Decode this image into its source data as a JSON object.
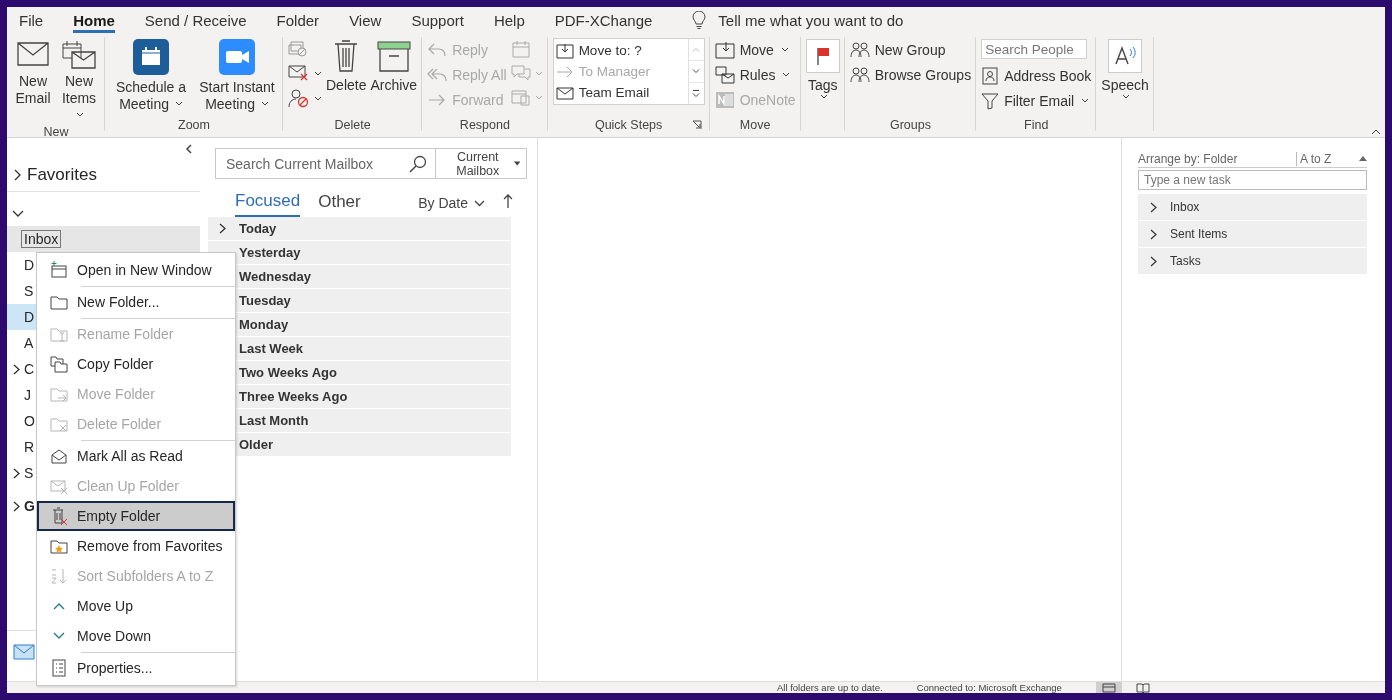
{
  "ribbon_tabs": [
    {
      "label": "File",
      "selected": false
    },
    {
      "label": "Home",
      "selected": true
    },
    {
      "label": "Send / Receive",
      "selected": false
    },
    {
      "label": "Folder",
      "selected": false
    },
    {
      "label": "View",
      "selected": false
    },
    {
      "label": "Support",
      "selected": false
    },
    {
      "label": "Help",
      "selected": false
    },
    {
      "label": "PDF-XChange",
      "selected": false
    }
  ],
  "tell_me": {
    "text": "Tell me what you want to do"
  },
  "ribbon": {
    "new": {
      "label": "New",
      "buttons": [
        {
          "label": "New Email",
          "dropdown": false
        },
        {
          "label": "New Items",
          "dropdown": true
        }
      ]
    },
    "zoom": {
      "label": "Zoom",
      "buttons": [
        {
          "label": "Schedule a Meeting",
          "dropdown": true
        },
        {
          "label": "Start Instant Meeting",
          "dropdown": true
        }
      ]
    },
    "delete": {
      "label": "Delete",
      "buttons": [
        {
          "label": "Delete"
        },
        {
          "label": "Archive"
        }
      ]
    },
    "respond": {
      "label": "Respond",
      "buttons": [
        {
          "label": "Reply",
          "disabled": true
        },
        {
          "label": "Reply All",
          "disabled": true
        },
        {
          "label": "Forward",
          "disabled": true
        }
      ]
    },
    "quick_steps": {
      "label": "Quick Steps",
      "items": [
        {
          "label": "Move to: ?",
          "disabled": false
        },
        {
          "label": "To Manager",
          "disabled": true
        },
        {
          "label": "Team Email",
          "disabled": false
        }
      ]
    },
    "move": {
      "label": "Move",
      "buttons": [
        {
          "label": "Move",
          "dropdown": true,
          "disabled": false
        },
        {
          "label": "Rules",
          "dropdown": true,
          "disabled": false
        },
        {
          "label": "OneNote",
          "dropdown": false,
          "disabled": true
        }
      ]
    },
    "tags": {
      "button": "Tags"
    },
    "groups": {
      "label": "Groups",
      "buttons": [
        "New Group",
        "Browse Groups"
      ]
    },
    "find": {
      "label": "Find",
      "search": {
        "placeholder": "Search People"
      },
      "buttons": [
        {
          "label": "Address Book",
          "dropdown": false
        },
        {
          "label": "Filter Email",
          "dropdown": true
        }
      ]
    },
    "speech": {
      "button": "Speech"
    }
  },
  "folder_pane": {
    "favorites": {
      "label": "Favorites",
      "expanded": false
    },
    "account": {
      "expanded": true
    },
    "folders": [
      {
        "label": "Inbox",
        "selected": false,
        "context_target": true,
        "collapsed": false,
        "bold": false
      },
      {
        "label": "D",
        "selected": false,
        "context_target": false,
        "collapsed": false,
        "bold": false
      },
      {
        "label": "S",
        "selected": false,
        "context_target": false,
        "collapsed": false,
        "bold": false
      },
      {
        "label": "D",
        "selected": true,
        "context_target": false,
        "collapsed": false,
        "bold": false
      },
      {
        "label": "A",
        "selected": false,
        "context_target": false,
        "collapsed": false,
        "bold": false
      },
      {
        "label": "C",
        "selected": false,
        "context_target": false,
        "collapsed": true,
        "bold": false
      },
      {
        "label": "J",
        "selected": false,
        "context_target": false,
        "collapsed": false,
        "bold": false
      },
      {
        "label": "O",
        "selected": false,
        "context_target": false,
        "collapsed": false,
        "bold": false
      },
      {
        "label": "R",
        "selected": false,
        "context_target": false,
        "collapsed": false,
        "bold": false
      },
      {
        "label": "S",
        "selected": false,
        "context_target": false,
        "collapsed": true,
        "bold": false
      },
      {
        "label": "G",
        "selected": false,
        "context_target": false,
        "collapsed": true,
        "bold": true
      }
    ]
  },
  "message_list": {
    "search": {
      "placeholder": "Search Current Mailbox"
    },
    "scope": "Current Mailbox",
    "tabs": [
      {
        "label": "Focused",
        "selected": true
      },
      {
        "label": "Other",
        "selected": false
      }
    ],
    "sort": "By Date",
    "groups": [
      {
        "label": "Today",
        "collapsed": true
      },
      {
        "label": "Yesterday"
      },
      {
        "label": "Wednesday"
      },
      {
        "label": "Tuesday"
      },
      {
        "label": "Monday"
      },
      {
        "label": "Last Week"
      },
      {
        "label": "Two Weeks Ago"
      },
      {
        "label": "Three Weeks Ago"
      },
      {
        "label": "Last Month"
      },
      {
        "label": "Older"
      }
    ]
  },
  "context_menu": [
    {
      "label": "Open in New Window",
      "disabled": false,
      "selected": false,
      "separator_after": true
    },
    {
      "label": "New Folder...",
      "disabled": false,
      "selected": false,
      "separator_after": true
    },
    {
      "label": "Rename Folder",
      "disabled": true,
      "selected": false,
      "separator_after": false
    },
    {
      "label": "Copy Folder",
      "disabled": false,
      "selected": false,
      "separator_after": false
    },
    {
      "label": "Move Folder",
      "disabled": true,
      "selected": false,
      "separator_after": false
    },
    {
      "label": "Delete Folder",
      "disabled": true,
      "selected": false,
      "separator_after": true
    },
    {
      "label": "Mark All as Read",
      "disabled": false,
      "selected": false,
      "separator_after": false
    },
    {
      "label": "Clean Up Folder",
      "disabled": true,
      "selected": false,
      "separator_after": false
    },
    {
      "label": "Empty Folder",
      "disabled": false,
      "selected": true,
      "separator_after": false
    },
    {
      "label": "Remove from Favorites",
      "disabled": false,
      "selected": false,
      "separator_after": false
    },
    {
      "label": "Sort Subfolders A to Z",
      "disabled": true,
      "selected": false,
      "separator_after": false
    },
    {
      "label": "Move Up",
      "disabled": false,
      "selected": false,
      "separator_after": false
    },
    {
      "label": "Move Down",
      "disabled": false,
      "selected": false,
      "separator_after": true
    },
    {
      "label": "Properties...",
      "disabled": false,
      "selected": false,
      "separator_after": false
    }
  ],
  "tasks_pane": {
    "arrange_by": "Arrange by: Folder",
    "order": "A to Z",
    "new_task": {
      "placeholder": "Type a new task"
    },
    "groups": [
      {
        "label": "Inbox",
        "expanded": false
      },
      {
        "label": "Sent Items",
        "expanded": false
      },
      {
        "label": "Tasks",
        "expanded": false
      }
    ]
  },
  "status_bar": {
    "messages": [
      "All folders are up to date.",
      "Connected to: Microsoft Exchange"
    ],
    "views": [
      {
        "selected": true
      },
      {
        "selected": false
      }
    ]
  }
}
